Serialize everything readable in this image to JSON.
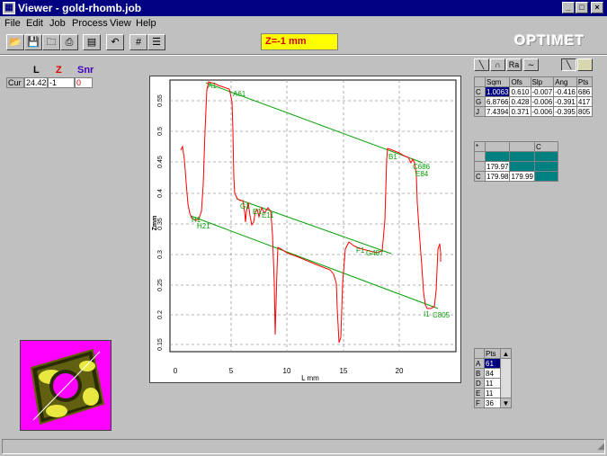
{
  "window": {
    "title": "Viewer - gold-rhomb.job",
    "controls": [
      "_",
      "□",
      "×"
    ]
  },
  "menu": [
    "File",
    "Edit",
    "Job",
    "Process",
    "View",
    "Help"
  ],
  "toolbar": {
    "buttons": [
      "open-icon",
      "save-icon",
      "folder-icon",
      "print-icon",
      "copy-icon",
      "undo-icon",
      "grid-icon",
      "table-icon"
    ],
    "z_readout": "Z=-1 mm",
    "logo": "OPTIMET"
  },
  "cursor": {
    "headers": [
      "L",
      "Z",
      "Snr"
    ],
    "header_colors": [
      "#000000",
      "#e00000",
      "#4000c0"
    ],
    "row_label": "Cur",
    "values": [
      "24.424",
      "-1",
      "0"
    ]
  },
  "plot": {
    "x_ticks": [
      "0",
      "5",
      "10",
      "15",
      "20"
    ],
    "y_ticks": [
      "0.15",
      "0.2",
      "0.25",
      "0.3",
      "0.35",
      "0.4",
      "0.45",
      "0.5",
      "0.55"
    ],
    "x_label": "L mm",
    "y_label": "Zmm",
    "markers": [
      "A1",
      "A61",
      "H1",
      "H21",
      "G1",
      "E1",
      "E11",
      "F1",
      "G487",
      "B1",
      "C686",
      "E84",
      "I1",
      "C805"
    ],
    "profile_color": "#ff0000",
    "fit_color": "#00a000"
  },
  "tool_buttons": [
    "line-icon",
    "arc-icon",
    "Ra",
    "wave-icon"
  ],
  "fit_table": {
    "headers": [
      "",
      "Sqm",
      "Ofs",
      "Slp",
      "Ang",
      "Pts"
    ],
    "rows": [
      [
        "C",
        "1.0063",
        "0.610",
        "-0.007",
        "-0.416",
        "686"
      ],
      [
        "G",
        "6.8766",
        "0.428",
        "-0.006",
        "-0.391",
        "417"
      ],
      [
        "J",
        "7.4394",
        "0.371",
        "-0.006",
        "-0.395",
        "805"
      ]
    ]
  },
  "angle_table": {
    "headers": [
      "*",
      "",
      "",
      "C"
    ],
    "rows": [
      [
        "",
        "",
        "",
        ""
      ],
      [
        "",
        "179.97",
        "",
        ""
      ],
      [
        "C",
        "179.98",
        "179.99",
        ""
      ]
    ]
  },
  "pts_table": {
    "header": "Pts",
    "rows": [
      [
        "A",
        "61"
      ],
      [
        "B",
        "84"
      ],
      [
        "D",
        "11"
      ],
      [
        "E",
        "11"
      ],
      [
        "F",
        "36"
      ]
    ]
  }
}
